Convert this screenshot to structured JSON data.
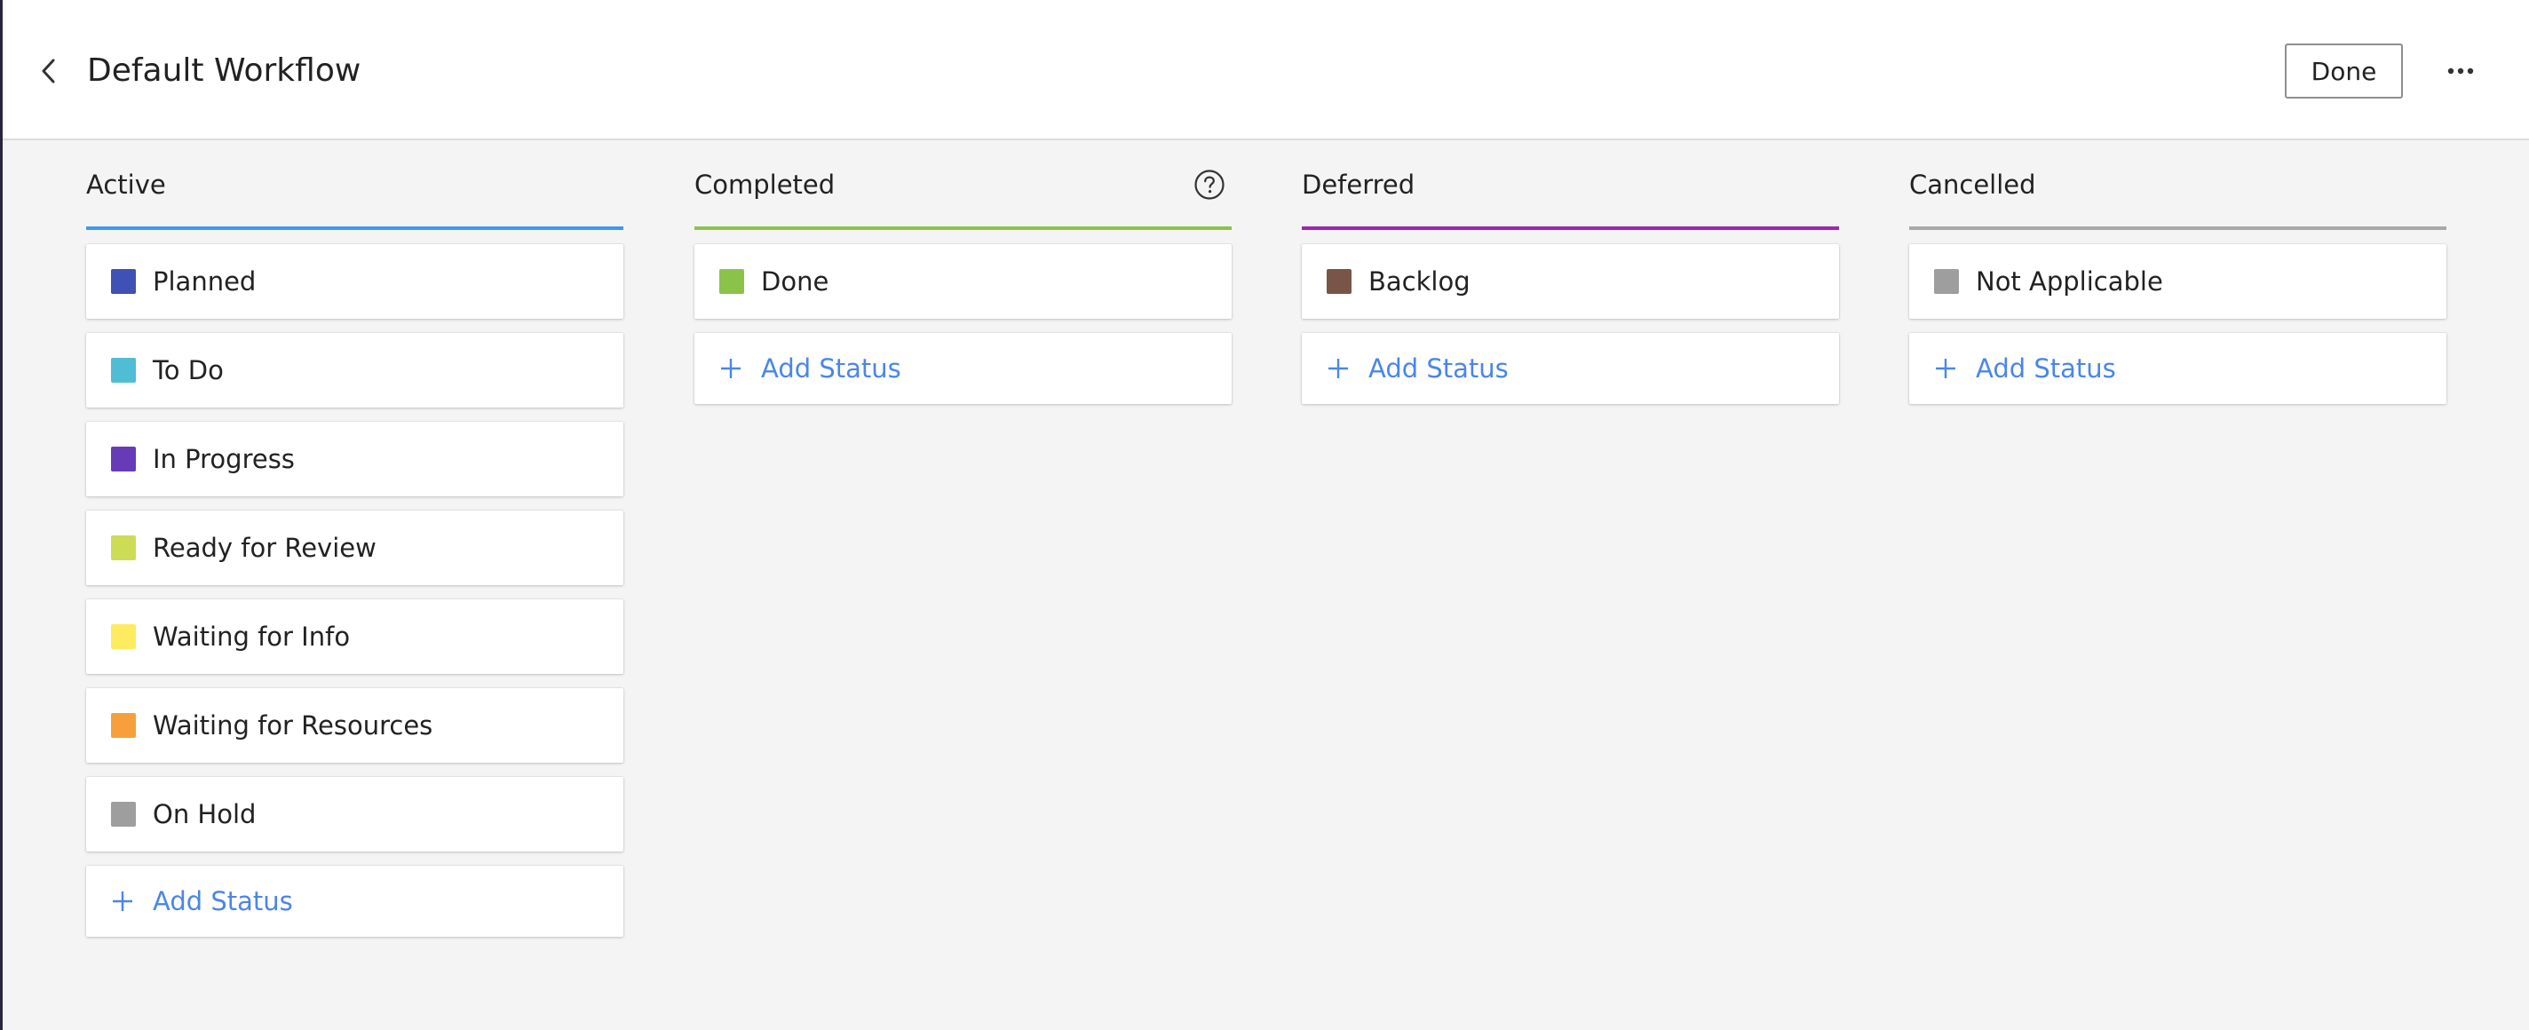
{
  "header": {
    "title": "Default Workflow",
    "done_label": "Done"
  },
  "icons": {
    "back": "chevron-left-icon",
    "more": "more-horizontal-icon",
    "help": "question-circle-icon",
    "add": "plus-icon"
  },
  "colors": {
    "accent_link": "#4a86e8"
  },
  "columns": [
    {
      "title": "Active",
      "underline_color": "#3d9be9",
      "has_help": false,
      "statuses": [
        {
          "label": "Planned",
          "color": "#3f51b5"
        },
        {
          "label": "To Do",
          "color": "#4fbdd4"
        },
        {
          "label": "In Progress",
          "color": "#673ab7"
        },
        {
          "label": "Ready for Review",
          "color": "#cddc55"
        },
        {
          "label": "Waiting for Info",
          "color": "#ffeb60"
        },
        {
          "label": "Waiting for Resources",
          "color": "#f7a03b"
        },
        {
          "label": "On Hold",
          "color": "#9e9e9e"
        }
      ],
      "add_label": "Add Status"
    },
    {
      "title": "Completed",
      "underline_color": "#8bc34a",
      "has_help": true,
      "statuses": [
        {
          "label": "Done",
          "color": "#8bc34a"
        }
      ],
      "add_label": "Add Status"
    },
    {
      "title": "Deferred",
      "underline_color": "#9c27b0",
      "has_help": false,
      "statuses": [
        {
          "label": "Backlog",
          "color": "#795548"
        }
      ],
      "add_label": "Add Status"
    },
    {
      "title": "Cancelled",
      "underline_color": "#a8a8a8",
      "has_help": false,
      "statuses": [
        {
          "label": "Not Applicable",
          "color": "#9e9e9e"
        }
      ],
      "add_label": "Add Status"
    }
  ]
}
